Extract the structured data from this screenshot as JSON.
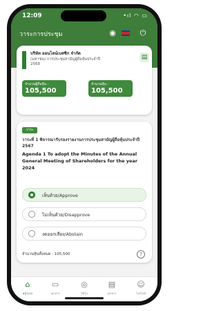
{
  "status_bar": {
    "time": "12:09",
    "icons": "•ıl ◠ ▭"
  },
  "app_bar": {
    "title": "วาระการประชุม"
  },
  "company": {
    "name": "บริษัท ออนไลน์เบสซิก จำกัด",
    "meeting_line": "(มหาชน) การประชุมสามัญผู้ถือหุ้นประจำปี",
    "year": "2568",
    "stat1_label": "จำนวนผู้ถือหุ้น :",
    "stat1_value": "105,500",
    "stat2_label": "จำนวนหุ้น :",
    "stat2_value": "105,500"
  },
  "agenda": {
    "badge": "วาระ",
    "title_th": "วาระที่ 1 พิจารณารับรองรายงานการประชุมสามัญผู้ถือหุ้นประจำปี 2567",
    "title_en": "Agenda 1 To adopt the Minutes of the Annual General Meeting of Shareholders for the year 2024",
    "options": [
      {
        "label": "เห็นด้วย/Approve"
      },
      {
        "label": "ไม่เห็นด้วย/Disapprove"
      },
      {
        "label": "งดออกเสียง/Abstain"
      }
    ],
    "shares_text": "จำนวนหุ้นทั้งหมด : 105,500"
  },
  "tabs": [
    {
      "label": "หน้าแรก",
      "icon": "home-icon"
    },
    {
      "label": "เอกสาร",
      "icon": "folder-icon"
    },
    {
      "label": "วิดีโอ",
      "icon": "video-icon"
    },
    {
      "label": "เอกสาร",
      "icon": "document-icon"
    },
    {
      "label": "โปรไฟล์",
      "icon": "user-icon"
    }
  ],
  "colors": {
    "brand_green": "#3f7d3a",
    "accent_green": "#2e7d32",
    "selected_bg": "#e8f5e6"
  }
}
